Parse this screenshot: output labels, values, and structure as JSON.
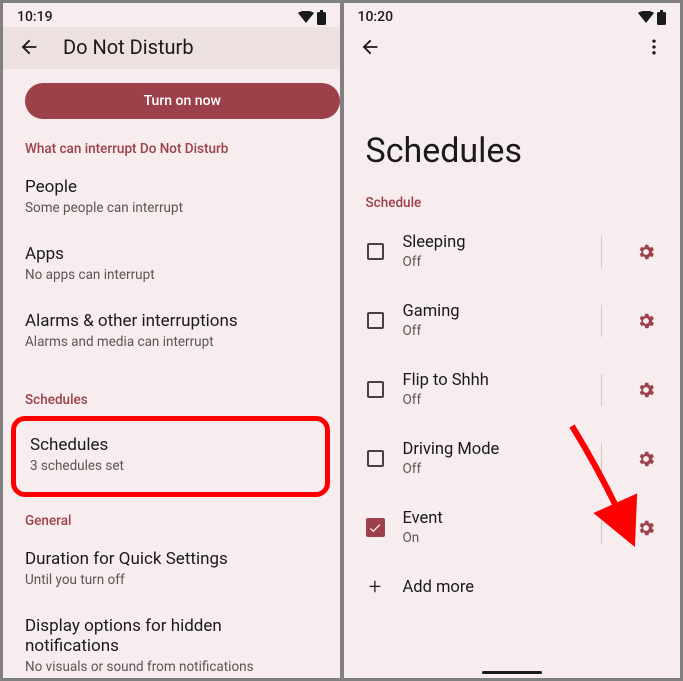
{
  "left": {
    "status_time": "10:19",
    "app_title": "Do Not Disturb",
    "turn_on_label": "Turn on now",
    "section_interrupt": "What can interrupt Do Not Disturb",
    "people": {
      "title": "People",
      "sub": "Some people can interrupt"
    },
    "apps": {
      "title": "Apps",
      "sub": "No apps can interrupt"
    },
    "alarms": {
      "title": "Alarms & other interruptions",
      "sub": "Alarms and media can interrupt"
    },
    "section_schedules": "Schedules",
    "schedules": {
      "title": "Schedules",
      "sub": "3 schedules set"
    },
    "section_general": "General",
    "duration": {
      "title": "Duration for Quick Settings",
      "sub": "Until you turn off"
    },
    "display": {
      "title": "Display options for hidden notifications",
      "sub": "No visuals or sound from notifications"
    }
  },
  "right": {
    "status_time": "10:20",
    "page_title": "Schedules",
    "section_schedule": "Schedule",
    "items": [
      {
        "title": "Sleeping",
        "sub": "Off",
        "checked": false
      },
      {
        "title": "Gaming",
        "sub": "Off",
        "checked": false
      },
      {
        "title": "Flip to Shhh",
        "sub": "Off",
        "checked": false
      },
      {
        "title": "Driving Mode",
        "sub": "Off",
        "checked": false
      },
      {
        "title": "Event",
        "sub": "On",
        "checked": true
      }
    ],
    "add_more": "Add more"
  }
}
